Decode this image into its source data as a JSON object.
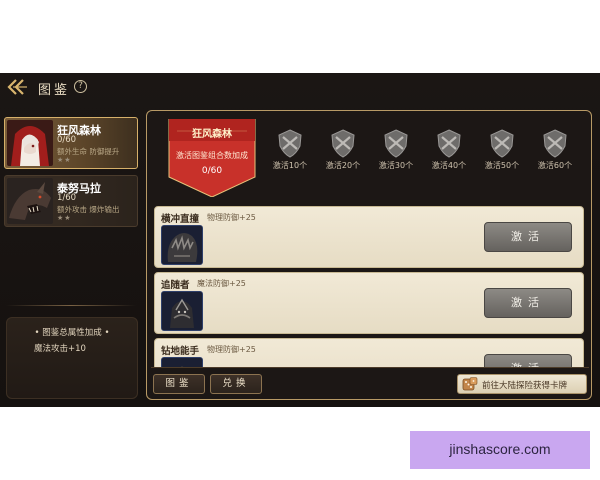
{
  "header": {
    "title": "图鉴",
    "help_glyph": "?",
    "back_icon": "double-chevron-left-icon"
  },
  "cards": [
    {
      "name": "狂风森林",
      "progress": "0/60",
      "description": "额外生命 防御提升",
      "stars": "★★",
      "selected": true
    },
    {
      "name": "泰努马拉",
      "progress": "1/60",
      "description": "额外攻击 爆炸输出",
      "stars": "★★",
      "selected": false
    }
  ],
  "bonus_panel": {
    "title": "• 图鉴总属性加成 •",
    "items": [
      "魔法攻击+10"
    ]
  },
  "banner": {
    "title": "狂风森林",
    "subtitle": "激活图鉴组合数加成",
    "count": "0/60",
    "color": "#c8312a"
  },
  "milestones": [
    {
      "label": "激活10个",
      "icon": "shield-icon"
    },
    {
      "label": "激活20个",
      "icon": "shield-icon"
    },
    {
      "label": "激活30个",
      "icon": "shield-icon"
    },
    {
      "label": "激活40个",
      "icon": "shield-icon"
    },
    {
      "label": "激活50个",
      "icon": "shield-icon"
    },
    {
      "label": "激活60个",
      "icon": "shield-icon"
    }
  ],
  "entries": [
    {
      "title": "横冲直撞",
      "stat": "物理防御+25",
      "button": "激活",
      "icon": "beast-portrait-icon"
    },
    {
      "title": "追随者",
      "stat": "魔法防御+25",
      "button": "激活",
      "icon": "monster-portrait-icon"
    },
    {
      "title": "钻地能手",
      "stat": "物理防御+25",
      "button": "激活",
      "icon": "driller-portrait-icon"
    }
  ],
  "bottom": {
    "codex_button": "图鉴",
    "exchange_button": "兑换",
    "explore_button": "前往大陆探险获得卡牌",
    "explore_icon": "dice-icon"
  },
  "watermark": {
    "text": "jinshascore.com"
  },
  "colors": {
    "accent_gold": "#d6b06a",
    "banner_red": "#c8312a",
    "entry_bg": "#f1e9d6",
    "button_gray": "#7a7772"
  }
}
